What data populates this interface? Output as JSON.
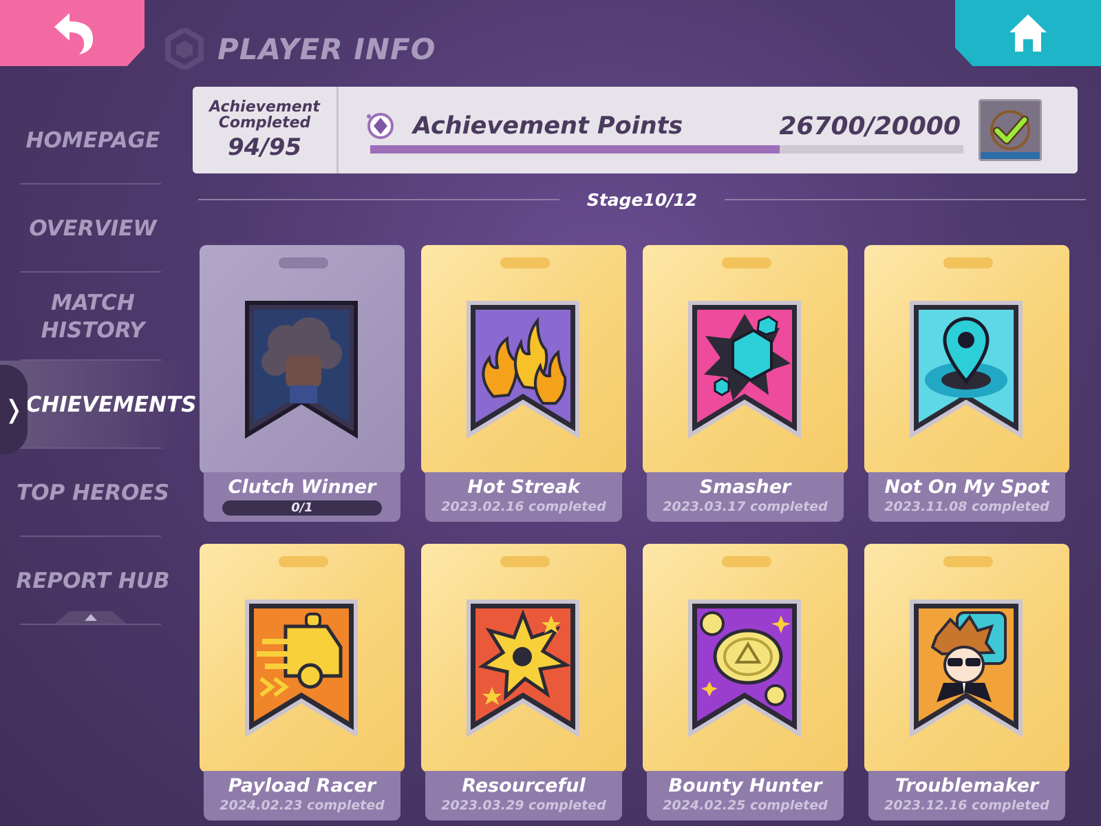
{
  "header": {
    "title": "PLAYER INFO",
    "back_icon": "back-arrow-icon",
    "home_icon": "home-icon"
  },
  "sidebar": {
    "items": [
      {
        "label": "HOMEPAGE",
        "active": false
      },
      {
        "label": "OVERVIEW",
        "active": false
      },
      {
        "label": "MATCH HISTORY",
        "active": false
      },
      {
        "label": "ACHIEVEMENTS",
        "active": true
      },
      {
        "label": "TOP HEROES",
        "active": false
      },
      {
        "label": "REPORT HUB",
        "active": false
      }
    ],
    "collapse_glyph": "❭"
  },
  "summary": {
    "completed_label": "Achievement Completed",
    "completed_value": "94/95",
    "points_label": "Achievement Points",
    "points_value": "26700/20000",
    "progress_fraction": 0.69,
    "claim_icon": "check-claim-icon"
  },
  "stage": {
    "label": "Stage10/12"
  },
  "colors": {
    "back_button": "#f36aa3",
    "home_button": "#1fb5c9",
    "progress_fill": "#9c6fb8",
    "card_gold": "#f8d47b",
    "card_footer": "#8f7cab"
  },
  "achievements": [
    {
      "name": "Clutch Winner",
      "date": "",
      "progress": "0/1",
      "locked": true,
      "icon": "fist-cloud-icon"
    },
    {
      "name": "Hot Streak",
      "date": "2023.02.16 completed",
      "progress": "",
      "locked": false,
      "icon": "flame-fists-icon"
    },
    {
      "name": "Smasher",
      "date": "2023.03.17 completed",
      "progress": "",
      "locked": false,
      "icon": "broken-cube-icon"
    },
    {
      "name": "Not On My Spot",
      "date": "2023.11.08 completed",
      "progress": "",
      "locked": false,
      "icon": "location-pin-icon"
    },
    {
      "name": "Payload Racer",
      "date": "2024.02.23 completed",
      "progress": "",
      "locked": false,
      "icon": "speeding-truck-icon"
    },
    {
      "name": "Resourceful",
      "date": "2023.03.29 completed",
      "progress": "",
      "locked": false,
      "icon": "explosion-icon"
    },
    {
      "name": "Bounty Hunter",
      "date": "2024.02.25 completed",
      "progress": "",
      "locked": false,
      "icon": "gold-coin-icon"
    },
    {
      "name": "Troublemaker",
      "date": "2023.12.16 completed",
      "progress": "",
      "locked": false,
      "icon": "sunglasses-hero-icon"
    }
  ]
}
